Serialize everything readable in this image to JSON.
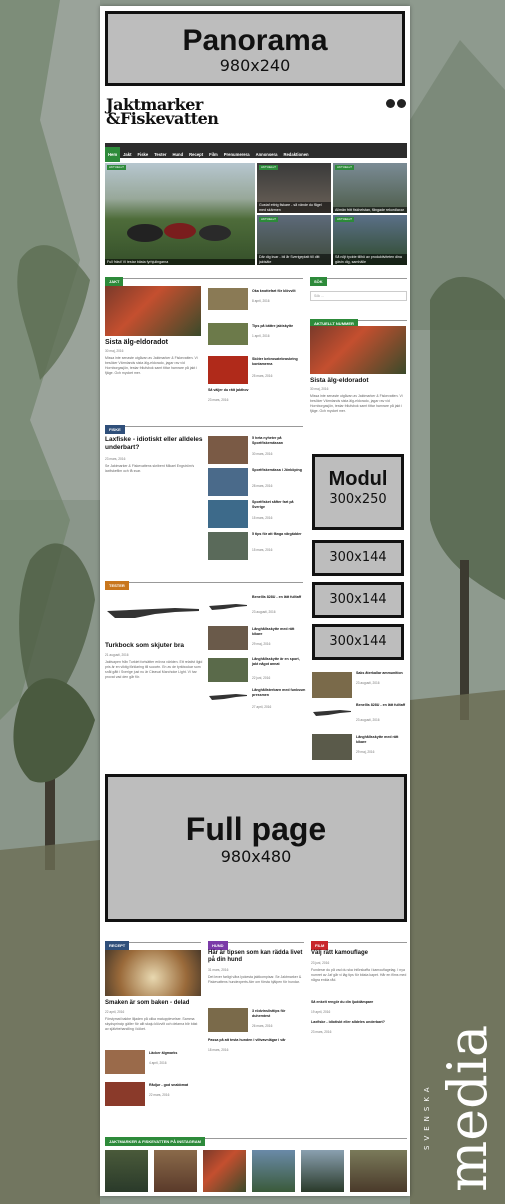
{
  "ads": {
    "panorama": {
      "label": "Panorama",
      "size": "980x240"
    },
    "modul": {
      "label": "Modul",
      "size": "300x250"
    },
    "small1": {
      "size": "300x144"
    },
    "small2": {
      "size": "300x144"
    },
    "small3": {
      "size": "300x144"
    },
    "fullpage": {
      "label": "Full page",
      "size": "980x480"
    }
  },
  "logo": {
    "line1": "Jaktmarker",
    "line2": "&Fiskevatten"
  },
  "nav": [
    "Hem",
    "Jakt",
    "Fiske",
    "Tester",
    "Hund",
    "Recept",
    "Film",
    "Prenumerera",
    "Annonsera",
    "Redaktionen"
  ],
  "hero": {
    "main": {
      "tag": "AKTUELLT",
      "caption": "Full fräst! Vi testar bästa fyrhjulingarna"
    },
    "items": [
      {
        "tag": "AKTUELLT",
        "caption": "Gustaf ettrig fiskare - så vände du fågel med skärmen"
      },
      {
        "tag": "AKTUELLT",
        "caption": "Allmän fritt fiskhelstan, fångade rekordlaxar"
      },
      {
        "tag": "AKTUELLT",
        "caption": "Där dig kvar - bli år Sverigeplatt till ditt jaktsäte"
      },
      {
        "tag": "AKTUELLT",
        "caption": "Så nöjt tyckte tillhö av produktiviteten dina gästn dig, samhälle"
      }
    ]
  },
  "jakt": {
    "label": "JAKT",
    "main": {
      "title": "Sista älg-eldoradot",
      "meta": "30 maj, 2016",
      "body": "Missa inte senaste utgåvan av Jaktmarker & Fiskevatten. Vi besöker Värmlands sista älg-eldorado, jagar rav vid Hornborgasjön, testar frilufsbok samt tittar hamrare på jakt i fjäge. Och mycket mer."
    },
    "list": [
      {
        "title": "Oka knottefart för klövvilt",
        "meta": "8 april, 2016"
      },
      {
        "title": "Tips på bättre jaktskytte",
        "meta": "1 april, 2016"
      },
      {
        "title": "Sköter bebrosatebraskring kontamerna",
        "meta": "25 mars, 2016"
      },
      {
        "title": "Så väljer du rätt jakthov",
        "meta": "23 mars, 2016"
      }
    ]
  },
  "fiske": {
    "label": "FISKE",
    "main": {
      "title": "Laxfiske - idiotiskt eller alldeles underbart?",
      "meta": "23 mars, 2016",
      "body": "Se Jaktmarker & Fiskevattens skribent Mikael Engström's laxfiskefilm och få svar."
    },
    "list": [
      {
        "title": "5 heta nyheter på Sportfiskemässan",
        "meta": "30 mars, 2016"
      },
      {
        "title": "Sportfiskemässa i Jönköping",
        "meta": "28 mars, 2016"
      },
      {
        "title": "Sportfisket såfter fart på Sverige",
        "meta": "15 mars, 2016"
      },
      {
        "title": "5 tips för att fånga vårgädder",
        "meta": "15 mars, 2016"
      }
    ]
  },
  "tester": {
    "label": "TESTER",
    "main": {
      "title": "Turkbock som skjuter bra",
      "meta": "21 augusti, 2016",
      "body": "Jaktvapen från Turkiet fortsätter erövra världen. Ett relativt ilgid pris är en viktig förklaring till succén. En av de tyrkbockar som snål gått i Sverige just nu är Cleaval Marchoke Light. Vi har provat vad den går för."
    },
    "list": [
      {
        "title": "Benellis 828U - en lätt fulltaff",
        "meta": "23 augusti, 2016"
      },
      {
        "title": "Långhållsskytte med rätt kikare",
        "meta": "29 maj, 2016"
      },
      {
        "title": "Långhållsskytte är en sport, jakt något annat",
        "meta": "22 juni, 2016"
      },
      {
        "title": "Långhållsterbarn med funkssm pressmen",
        "meta": "27 april, 2016"
      }
    ]
  },
  "sidebar": {
    "search_label": "SÖK",
    "search_placeholder": "Sök ...",
    "current_label": "AKTUELLT NUMMER",
    "current": {
      "title": "Sista älg-eldoradot",
      "meta": "30 maj, 2016",
      "body": "Missa inte senaste utgåvan av Jaktmarker & Fiskevatten. Vi besöker Värmlands sista älg-eldorado, jagar rav vid Hornborgasjön, testar frilufsbok samt tittar hamrare på jakt i fjäge. Och mycket mer."
    },
    "list": [
      {
        "title": "Saks återkallar ammunition",
        "meta": "23 augusti, 2016"
      },
      {
        "title": "Benellis 828U - en lätt fulltaff",
        "meta": "23 augusti, 2016"
      },
      {
        "title": "Långhållsskytte med rätt kikare",
        "meta": "29 maj, 2016"
      }
    ]
  },
  "recept": {
    "label": "RECEPT",
    "main": {
      "title": "Smaken är som baken - delad",
      "meta": "22 april, 2016",
      "body": "Förstymat bakbe liljaden på olika matupplevelser. Samma skydsprincip gäller för allt skaju klövvilt och delarna blir bäst av självbehandling i köket."
    },
    "list": [
      {
        "title": "Läcker älgmarks",
        "meta": "4 april, 2016"
      },
      {
        "title": "Rådjur - god snabbmat",
        "meta": "22 mars, 2016"
      }
    ]
  },
  "hund": {
    "label": "HUND",
    "main": {
      "title": "Här är tipsen som kan rädda livet på din hund",
      "meta": "31 mars, 2016",
      "body": "Det lever farligt våra lyckesta jaktkompisar. Se Jaktmarker & Fiskevattens hundexperts-färr om första hjälpen för hundar."
    },
    "list": [
      {
        "title": "3 rödvinslisttips för duhemtest",
        "meta": "26 mars, 2016"
      },
      {
        "title": "Passa på att testa hunden i viltvavnlägar i vår",
        "meta": "18 mars, 2016"
      }
    ]
  },
  "film": {
    "label": "FILM",
    "main": {
      "title": "Välj rätt kamouflage",
      "meta": "23 juni, 2016",
      "body": "Funderar du på vad du ska införskaffa i kamouflagelag. I nya numret av Jaf går vi läg tips för bästa kapet. Hår en films med några enkla råd."
    },
    "list": [
      {
        "title": "Så enkelt rengör du din ljuddämpare",
        "meta": "19 april, 2016"
      },
      {
        "title": "Laxfiske - idiotiskt eller alldeles underbart?",
        "meta": "23 mars, 2016"
      }
    ]
  },
  "instagram": {
    "label": "JAKTMARKER & FISKEVATTEN PÅ INSTAGRAM"
  },
  "brand": {
    "top": "SVENSKA",
    "word": "media"
  },
  "colors": {
    "green": "#2d8a3a",
    "blue": "#2f4f7a",
    "orange": "#c8761d",
    "purple": "#7b3aa8",
    "red": "#c8262b",
    "nav": "#2c2c2c"
  }
}
